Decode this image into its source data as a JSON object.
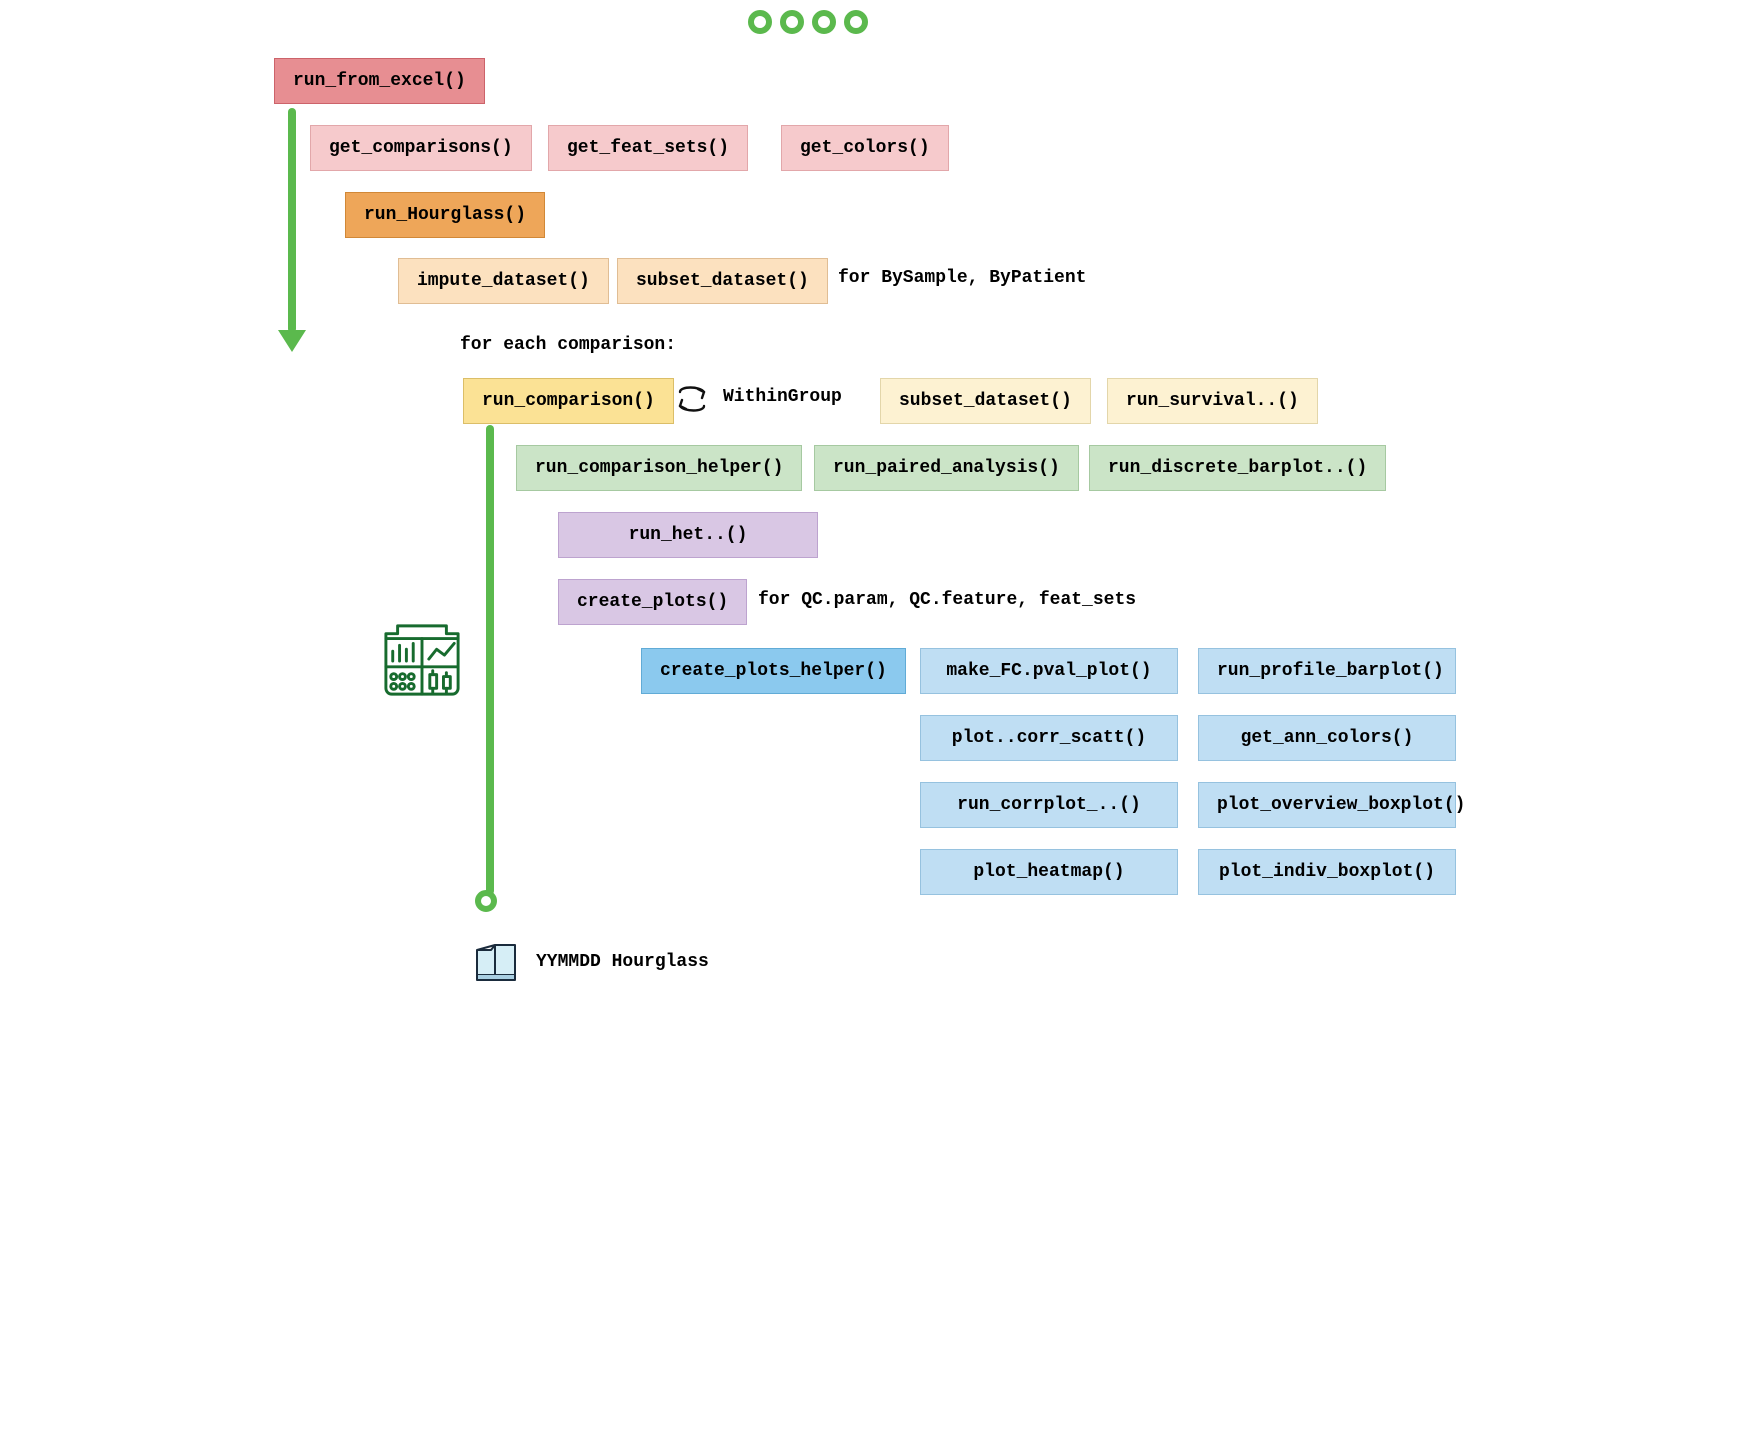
{
  "circles_count": 4,
  "boxes": {
    "run_from_excel": "run_from_excel()",
    "get_comparisons": "get_comparisons()",
    "get_feat_sets": "get_feat_sets()",
    "get_colors": "get_colors()",
    "run_hourglass": "run_Hourglass()",
    "impute_dataset": "impute_dataset()",
    "subset_dataset1": "subset_dataset()",
    "run_comparison": "run_comparison()",
    "subset_dataset2": "subset_dataset()",
    "run_survival": "run_survival..()",
    "run_comparison_helper": "run_comparison_helper()",
    "run_paired_analysis": "run_paired_analysis()",
    "run_discrete_barplot": "run_discrete_barplot..()",
    "run_het": "run_het..()",
    "create_plots": "create_plots()",
    "create_plots_helper": "create_plots_helper()",
    "make_fc_pval_plot": "make_FC.pval_plot()",
    "run_profile_barplot": "run_profile_barplot()",
    "plot_corr_scatt": "plot..corr_scatt()",
    "get_ann_colors": "get_ann_colors()",
    "run_corrplot": "run_corrplot_..()",
    "plot_overview_boxplot": "plot_overview_boxplot()",
    "plot_heatmap": "plot_heatmap()",
    "plot_indiv_boxplot": "plot_indiv_boxplot()"
  },
  "labels": {
    "for_bysample": "for BySample, ByPatient",
    "for_each_comparison": "for each comparison:",
    "within_group": "WithinGroup",
    "for_qc": "for QC.param, QC.feature, feat_sets",
    "folder_label": "YYMMDD Hourglass"
  },
  "icons": {
    "swap": "swap-arrows-icon",
    "plot": "plot-output-icon",
    "folder": "folder-icon",
    "circle": "progress-circle-icon"
  },
  "colors": {
    "accent_green": "#5bb94d",
    "ink": "#176b2e"
  }
}
